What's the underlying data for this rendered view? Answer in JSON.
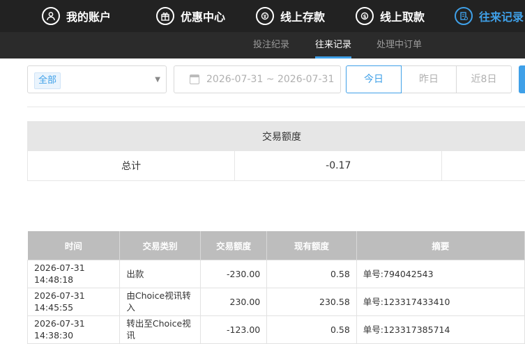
{
  "nav": [
    {
      "label": "我的账户",
      "icon": "user-icon",
      "active": false
    },
    {
      "label": "优惠中心",
      "icon": "gift-icon",
      "active": false
    },
    {
      "label": "线上存款",
      "icon": "deposit-icon",
      "active": false
    },
    {
      "label": "线上取款",
      "icon": "withdraw-icon",
      "active": false
    },
    {
      "label": "往来记录",
      "icon": "records-icon",
      "active": true
    }
  ],
  "subnav": [
    {
      "label": "投注纪录",
      "active": false
    },
    {
      "label": "往来记录",
      "active": true
    },
    {
      "label": "处理中订单",
      "active": false
    }
  ],
  "filter": {
    "type_value": "全部",
    "date_range": "2026-07-31 ~ 2026-07-31",
    "quick": [
      "今日",
      "昨日",
      "近8日"
    ],
    "selected_quick": "今日"
  },
  "summary": {
    "header": "交易额度",
    "row_label": "总计",
    "total": "-0.17"
  },
  "detail": {
    "columns": [
      "时间",
      "交易类别",
      "交易额度",
      "现有额度",
      "摘要"
    ],
    "rows": [
      {
        "time": "2026-07-31 14:48:18",
        "type": "出款",
        "amount": "-230.00",
        "balance": "0.58",
        "memo": "单号:794042543"
      },
      {
        "time": "2026-07-31 14:45:55",
        "type": "由Choice视讯转入",
        "amount": "230.00",
        "balance": "230.58",
        "memo": "单号:123317433410"
      },
      {
        "time": "2026-07-31 14:38:30",
        "type": "转出至Choice视讯",
        "amount": "-123.00",
        "balance": "0.58",
        "memo": "单号:123317385714"
      }
    ]
  },
  "colors": {
    "accent": "#3fa0e8",
    "nav_bg": "#222222",
    "subnav_bg": "#2b2b2b",
    "table_header": "#bdbdbd"
  }
}
